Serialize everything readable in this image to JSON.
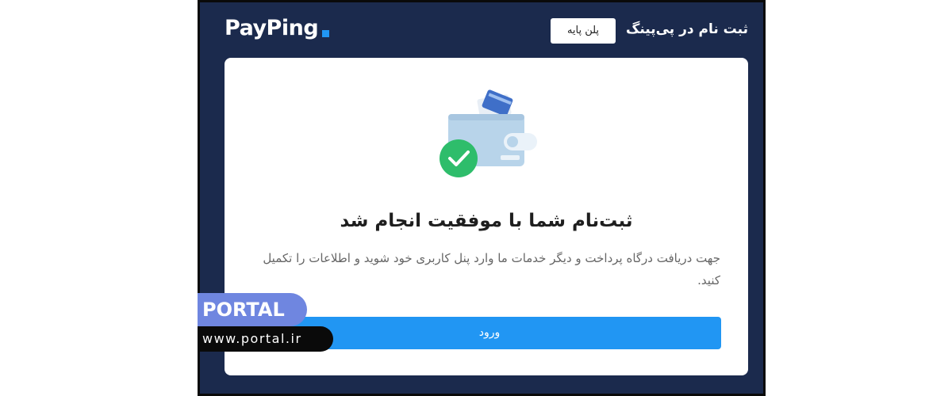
{
  "header": {
    "logo_text": "PayPing",
    "title": "ثبت نام در پی‌پینگ",
    "plan_badge": "پلن پایه"
  },
  "card": {
    "illustration_icon": "wallet-with-cards-and-check-icon",
    "success_title": "ثبت‌نام شما با موفقیت انجام شد",
    "description": "جهت دریافت درگاه پرداخت و دیگر خدمات ما وارد پنل کاربری خود شوید و اطلاعات را تکمیل کنید.",
    "login_button": "ورود"
  },
  "watermark": {
    "brand": "PORTAL",
    "url": "www.portal.ir"
  },
  "colors": {
    "header_background": "#1b2a4d",
    "accent": "#2196f3",
    "success": "#2ebd6b",
    "watermark_brand": "#6f86e0"
  }
}
